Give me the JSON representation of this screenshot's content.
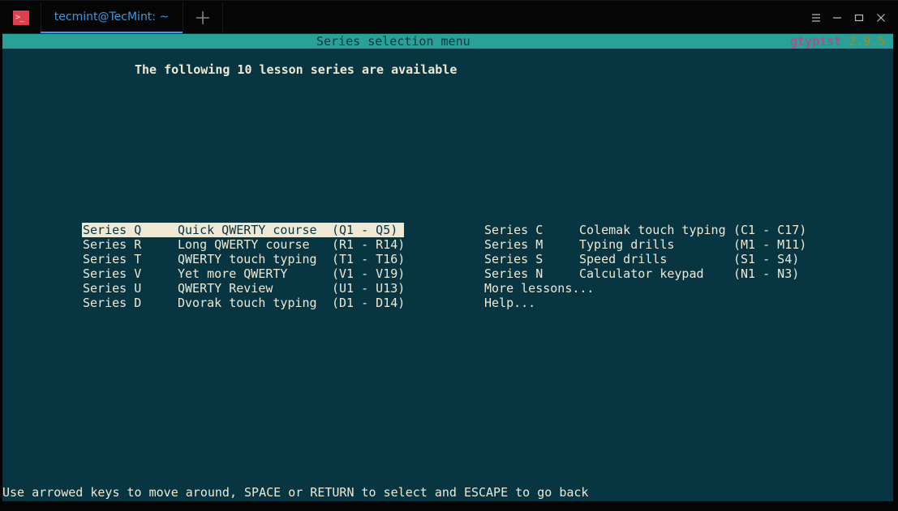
{
  "window": {
    "tab_title": "tecmint@TecMint: ~",
    "icons": {
      "app": "terminal-icon",
      "new_tab": "plus-icon",
      "menu": "hamburger-icon",
      "minimize": "minimize-icon",
      "maximize": "maximize-icon",
      "close": "close-icon"
    },
    "app_icon_glyph": ">_"
  },
  "header": {
    "title": "Series selection menu",
    "app_name": "gtypist",
    "version": "2.9.5"
  },
  "heading": "The following 10 lesson series are available",
  "colors": {
    "background": "#073642",
    "header_bar": "#2aa198",
    "text": "#eee8d5",
    "app_name": "#d33682",
    "version": "#b58900",
    "tab_accent": "#3a9be0",
    "app_icon": "#e0404e"
  },
  "menu": {
    "left": [
      {
        "series": "Series Q",
        "name": "Quick QWERTY course",
        "range": "(Q1 - Q5)",
        "selected": true
      },
      {
        "series": "Series R",
        "name": "Long QWERTY course",
        "range": "(R1 - R14)",
        "selected": false
      },
      {
        "series": "Series T",
        "name": "QWERTY touch typing",
        "range": "(T1 - T16)",
        "selected": false
      },
      {
        "series": "Series V",
        "name": "Yet more QWERTY",
        "range": "(V1 - V19)",
        "selected": false
      },
      {
        "series": "Series U",
        "name": "QWERTY Review",
        "range": "(U1 - U13)",
        "selected": false
      },
      {
        "series": "Series D",
        "name": "Dvorak touch typing",
        "range": "(D1 - D14)",
        "selected": false
      }
    ],
    "right": [
      {
        "series": "Series C",
        "name": "Colemak touch typing",
        "range": "(C1 - C17)"
      },
      {
        "series": "Series M",
        "name": "Typing drills",
        "range": "(M1 - M11)"
      },
      {
        "series": "Series S",
        "name": "Speed drills",
        "range": "(S1 - S4)"
      },
      {
        "series": "Series N",
        "name": "Calculator keypad",
        "range": "(N1 - N3)"
      },
      {
        "series": "",
        "name": "More lessons...",
        "range": ""
      },
      {
        "series": "",
        "name": "Help...",
        "range": ""
      }
    ]
  },
  "status": "Use arrowed keys to move around, SPACE or RETURN to select and ESCAPE to go back"
}
